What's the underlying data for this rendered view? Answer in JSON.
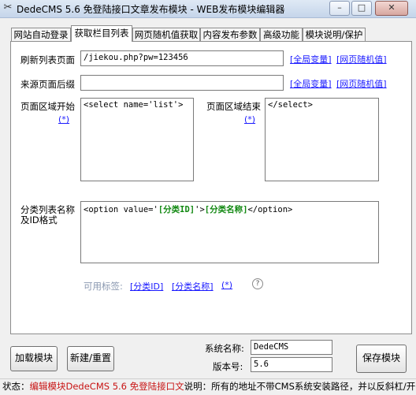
{
  "window": {
    "title": "DedeCMS 5.6 免登陆接口文章发布模块 - WEB发布模块编辑器",
    "icon": "tools-icon",
    "minimize": "–",
    "maximize": "□",
    "close": "✕"
  },
  "tabs": [
    {
      "label": "网站自动登录"
    },
    {
      "label": "获取栏目列表"
    },
    {
      "label": "网页随机值获取"
    },
    {
      "label": "内容发布参数"
    },
    {
      "label": "高级功能"
    },
    {
      "label": "模块说明/保护"
    }
  ],
  "form": {
    "refresh_label": "刷新列表页面",
    "refresh_value": "/jiekou.php?pw=123456",
    "source_suffix_label": "来源页面后缀",
    "source_suffix_value": "",
    "global_var_link": "[全局变量]",
    "random_value_link": "[网页随机值]",
    "region_start_label": "页面区域开始",
    "region_start_star": "(*)",
    "region_start_value": "<select name='list'>",
    "region_end_label": "页面区域结束",
    "region_end_star": "(*)",
    "region_end_value": "</select>",
    "category_label_line1": "分类列表名称",
    "category_label_line2": "及ID格式",
    "category_value_prefix": "<option value='",
    "category_tag_id": "[分类ID]",
    "category_value_mid": "'>",
    "category_tag_name": "[分类名称]",
    "category_value_suffix": "</option>",
    "available_tags_label": "可用标签:",
    "tag_id_link": "[分类ID]",
    "tag_name_link": "[分类名称]",
    "tag_star_link": "(*)",
    "hint_icon": "?"
  },
  "bottom": {
    "load_button": "加载模块",
    "new_button": "新建/重置",
    "system_name_label": "系统名称:",
    "system_name_value": "DedeCMS",
    "version_label": "版本号:",
    "version_value": "5.6",
    "save_button": "保存模块"
  },
  "status": {
    "prefix": "状态：",
    "editing": "编辑模块DedeCMS 5.6 免登陆接口文",
    "note": "说明：所有的地址不带CMS系统安装路径，并以反斜杠/开头，"
  },
  "colors": {
    "link": "#1a1aff",
    "status_red": "#c81414",
    "tag_green": "#118811"
  }
}
